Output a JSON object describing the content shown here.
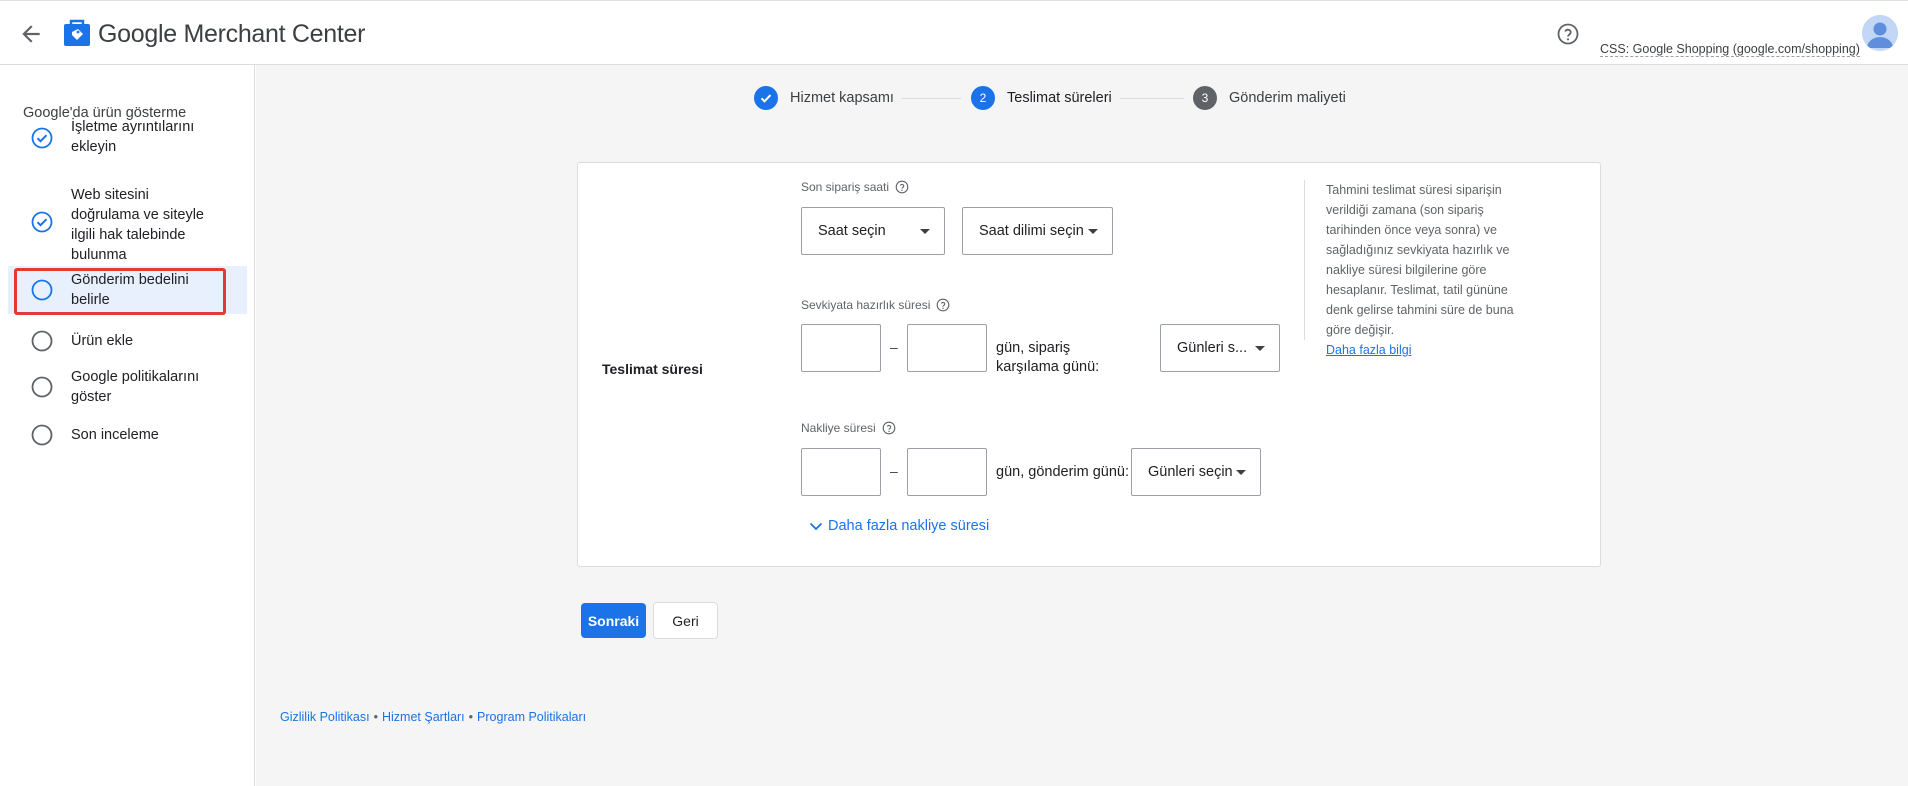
{
  "header": {
    "app_title": "Google Merchant Center",
    "css_link": "CSS: Google Shopping (google.com/shopping)",
    "back_icon": "arrow-back-icon",
    "help_icon": "help-circle-icon",
    "accent": "#1a73e8"
  },
  "sidebar": {
    "title": "Google'da ürün gösterme",
    "items": [
      {
        "label": "İşletme ayrıntılarını ekleyin",
        "status": "done"
      },
      {
        "label": "Web sitesini doğrulama ve siteyle ilgili hak talebinde bulunma",
        "status": "done"
      },
      {
        "label": "Gönderim bedelini belirle",
        "status": "current"
      },
      {
        "label": "Ürün ekle",
        "status": "todo"
      },
      {
        "label": "Google politikalarını göster",
        "status": "todo"
      },
      {
        "label": "Son inceleme",
        "status": "todo"
      }
    ]
  },
  "stepper": {
    "steps": [
      {
        "label": "Hizmet kapsamı",
        "state": "done",
        "number": ""
      },
      {
        "label": "Teslimat süreleri",
        "state": "active",
        "number": "2"
      },
      {
        "label": "Gönderim maliyeti",
        "state": "upcoming",
        "number": "3"
      }
    ]
  },
  "form": {
    "section_label": "Teslimat süresi",
    "cutoff": {
      "label": "Son sipariş saati",
      "time_select": "Saat seçin",
      "timezone_select": "Saat dilimi seçin"
    },
    "handling": {
      "label": "Sevkiyata hazırlık süresi",
      "min_value": "",
      "max_value": "",
      "separator": "–",
      "days_text": "gün, sipariş karşılama günü:",
      "days_select": "Günleri s..."
    },
    "transit": {
      "label": "Nakliye süresi",
      "min_value": "",
      "max_value": "",
      "separator": "–",
      "days_text": "gün, gönderim günü:",
      "days_select": "Günleri seçin"
    },
    "more_link": "Daha fazla nakliye süresi"
  },
  "info": {
    "text": "Tahmini teslimat süresi siparişin verildiği zamana (son sipariş tarihinden önce veya sonra) ve sağladığınız sevkiyata hazırlık ve nakliye süresi bilgilerine göre hesaplanır. Teslimat, tatil gününe denk gelirse tahmini süre de buna göre değişir.",
    "link": "Daha fazla bilgi"
  },
  "actions": {
    "next": "Sonraki",
    "back": "Geri"
  },
  "footer": {
    "links": [
      "Gizlilik Politikası",
      "Hizmet Şartları",
      "Program Politikaları"
    ],
    "separator": "•"
  }
}
